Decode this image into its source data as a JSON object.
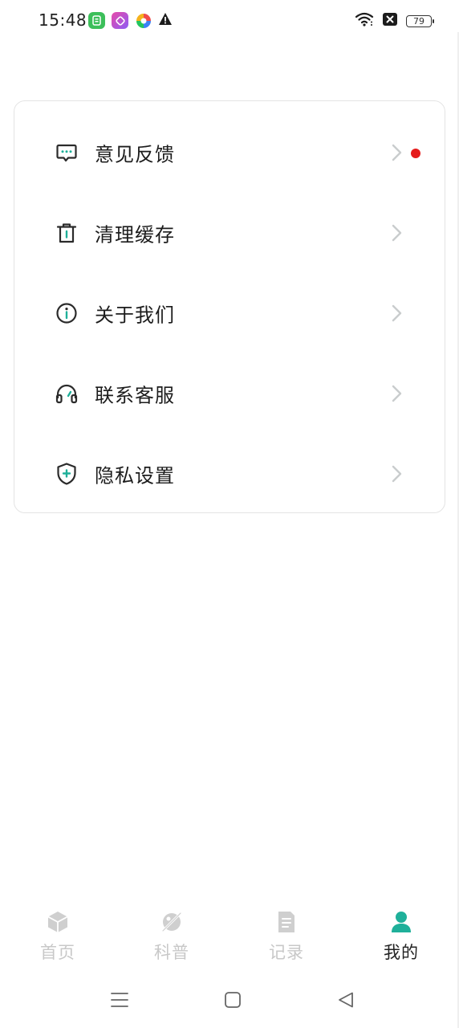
{
  "status_bar": {
    "time": "15:48",
    "battery": "79",
    "icons": [
      "app-green-icon",
      "app-pink-icon",
      "app-colorful-icon",
      "warning-icon",
      "wifi-icon",
      "notification-x-icon",
      "battery-icon"
    ]
  },
  "settings": {
    "items": [
      {
        "label": "意见反馈",
        "icon": "feedback-message-icon",
        "has_badge": true
      },
      {
        "label": "清理缓存",
        "icon": "trash-icon",
        "has_badge": false
      },
      {
        "label": "关于我们",
        "icon": "info-icon",
        "has_badge": false
      },
      {
        "label": "联系客服",
        "icon": "headset-icon",
        "has_badge": false
      },
      {
        "label": "隐私设置",
        "icon": "shield-icon",
        "has_badge": false
      }
    ]
  },
  "bottom_nav": {
    "tabs": [
      {
        "label": "首页",
        "icon": "home-cube-icon",
        "active": false
      },
      {
        "label": "科普",
        "icon": "science-icon",
        "active": false
      },
      {
        "label": "记录",
        "icon": "record-document-icon",
        "active": false
      },
      {
        "label": "我的",
        "icon": "profile-icon",
        "active": true
      }
    ]
  },
  "colors": {
    "accent": "#1fb09a",
    "icon_dark": "#2b2b2b",
    "badge": "#e51b1b",
    "inactive": "#c8c8c8",
    "chevron": "#c9cccd"
  }
}
